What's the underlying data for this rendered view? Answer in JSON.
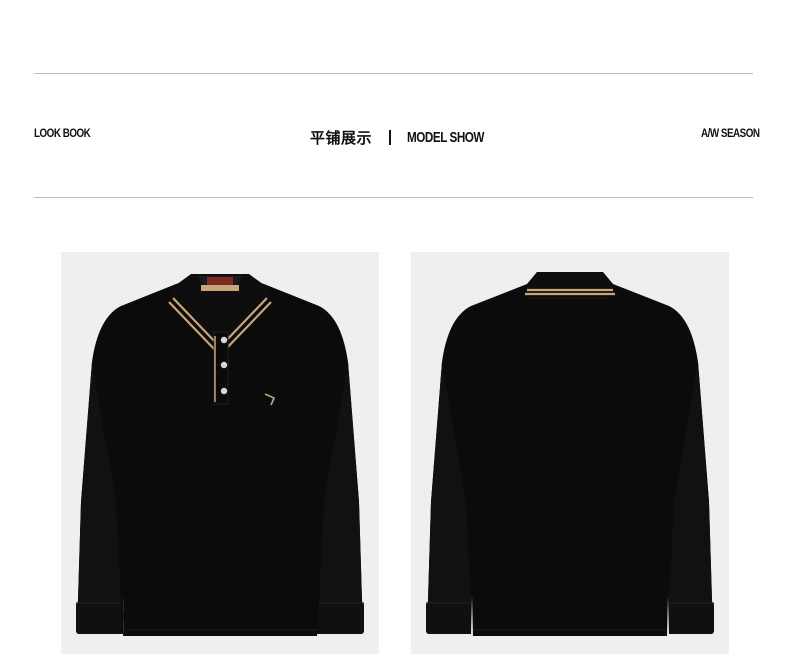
{
  "header": {
    "left_label": "LOOK BOOK",
    "title_cn": "平铺展示",
    "title_en": "MODEL SHOW",
    "right_label": "A/W SEASON"
  },
  "photos": [
    {
      "view": "front",
      "garment": "black long-sleeve polo shirt"
    },
    {
      "view": "back",
      "garment": "black long-sleeve polo shirt"
    }
  ],
  "colors": {
    "garment": "#0b0b0b",
    "collar_stripe": "#c9a57a",
    "photo_background": "#efefef",
    "rule": "#bdbdbd"
  }
}
